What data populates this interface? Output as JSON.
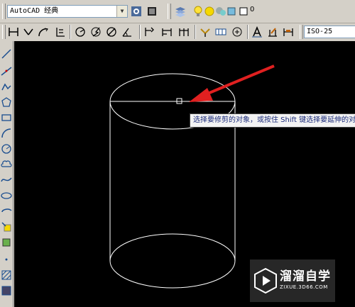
{
  "toolbar1": {
    "workspace_value": "AutoCAD 经典",
    "layer_value": "0"
  },
  "toolbar2": {
    "dimstyle_value": "ISO-25"
  },
  "tooltip": {
    "text": "选择要修剪的对象，或按住 Shift 键选择要延伸的对象"
  },
  "watermark": {
    "title": "溜溜自学",
    "subtitle": "ZIXUE.3D66.COM"
  },
  "colors": {
    "canvas_bg": "#000000",
    "drawing_line": "#ffffff",
    "arrow": "#e02020",
    "toolbar_bg": "#d4d0c8"
  }
}
